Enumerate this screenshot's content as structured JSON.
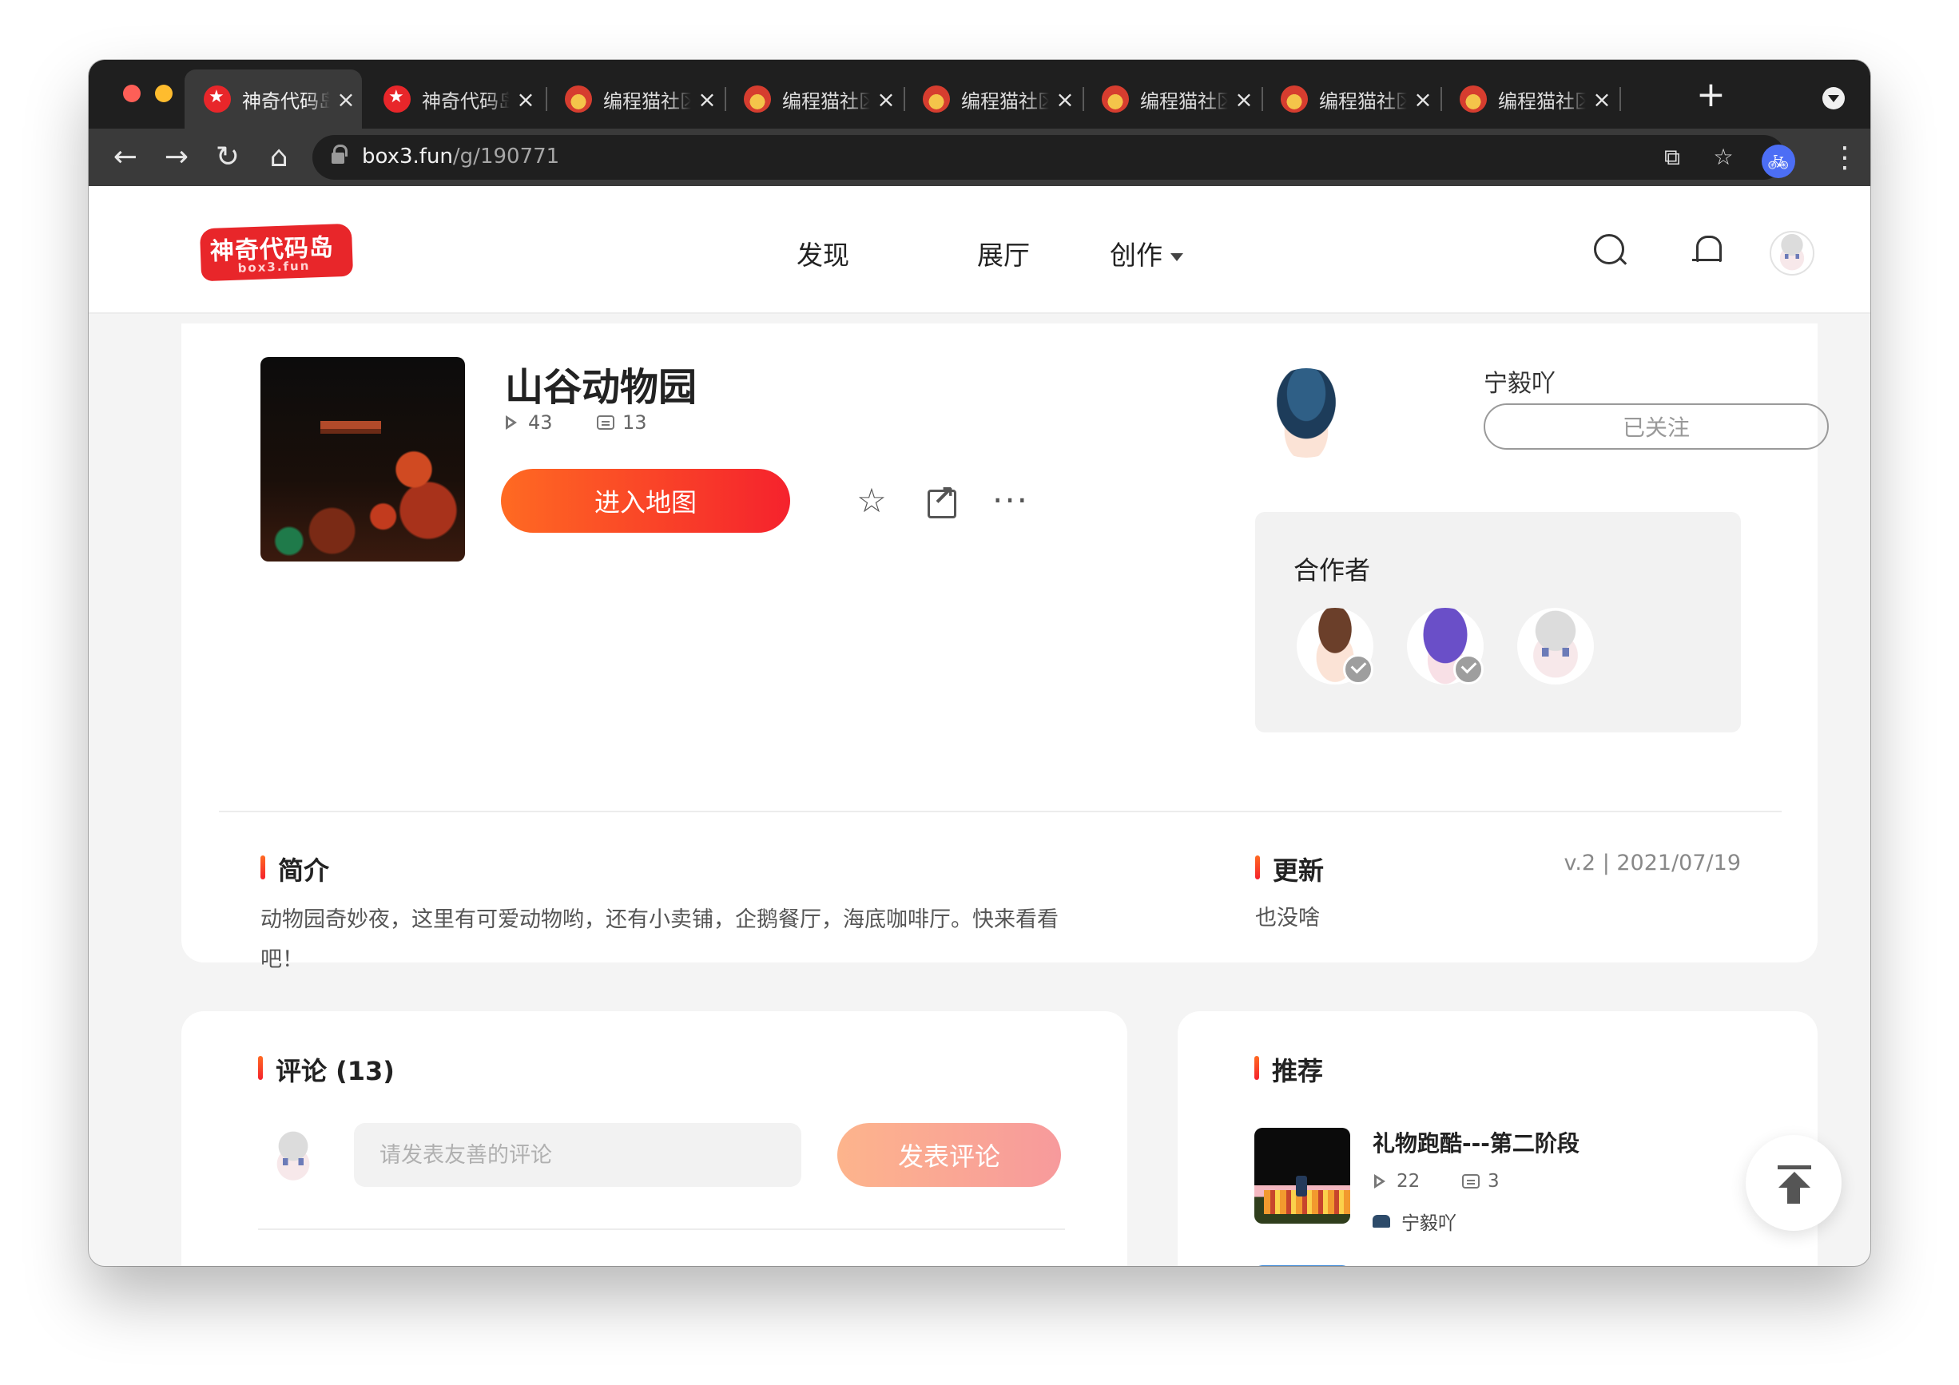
{
  "browser": {
    "tabs": [
      {
        "title": "神奇代码岛",
        "favicon": "star-favicon",
        "active": true
      },
      {
        "title": "神奇代码岛",
        "favicon": "star-favicon",
        "active": false
      },
      {
        "title": "编程猫社区",
        "favicon": "cat-favicon",
        "active": false
      },
      {
        "title": "编程猫社区",
        "favicon": "cat-favicon",
        "active": false
      },
      {
        "title": "编程猫社区",
        "favicon": "cat-favicon",
        "active": false
      },
      {
        "title": "编程猫社区",
        "favicon": "cat-favicon",
        "active": false
      },
      {
        "title": "编程猫社区",
        "favicon": "cat-favicon",
        "active": false
      },
      {
        "title": "编程猫社区",
        "favicon": "cat-favicon",
        "active": false
      }
    ],
    "url_host": "box3.fun",
    "url_path": "/g/190771"
  },
  "site": {
    "logo_text": "神奇代码岛",
    "logo_subtext": "box3.fun",
    "nav": {
      "discover": "发现",
      "gallery": "展厅",
      "create": "创作"
    }
  },
  "game": {
    "title": "山谷动物园",
    "plays": "43",
    "comments": "13",
    "enter_label": "进入地图",
    "description": "动物园奇妙夜，这里有可爱动物哟，还有小卖铺，企鹅餐厅，海底咖啡厅。快来看看吧！",
    "update_version": "v.2 | 2021/07/19",
    "update_text": "也没啥"
  },
  "author": {
    "name": "宁毅吖",
    "follow_label": "已关注"
  },
  "collaborators": {
    "title": "合作者"
  },
  "sections": {
    "intro": "简介",
    "update": "更新",
    "comments": "评论 (13)",
    "recommend": "推荐"
  },
  "comment_box": {
    "placeholder": "请发表友善的评论",
    "submit_label": "发表评论"
  },
  "recommendations": [
    {
      "title": "礼物跑酷---第二阶段",
      "plays": "22",
      "comments": "3",
      "author": "宁毅吖"
    }
  ],
  "colors": {
    "accent_start": "#ff6a22",
    "accent_end": "#f5222d"
  }
}
